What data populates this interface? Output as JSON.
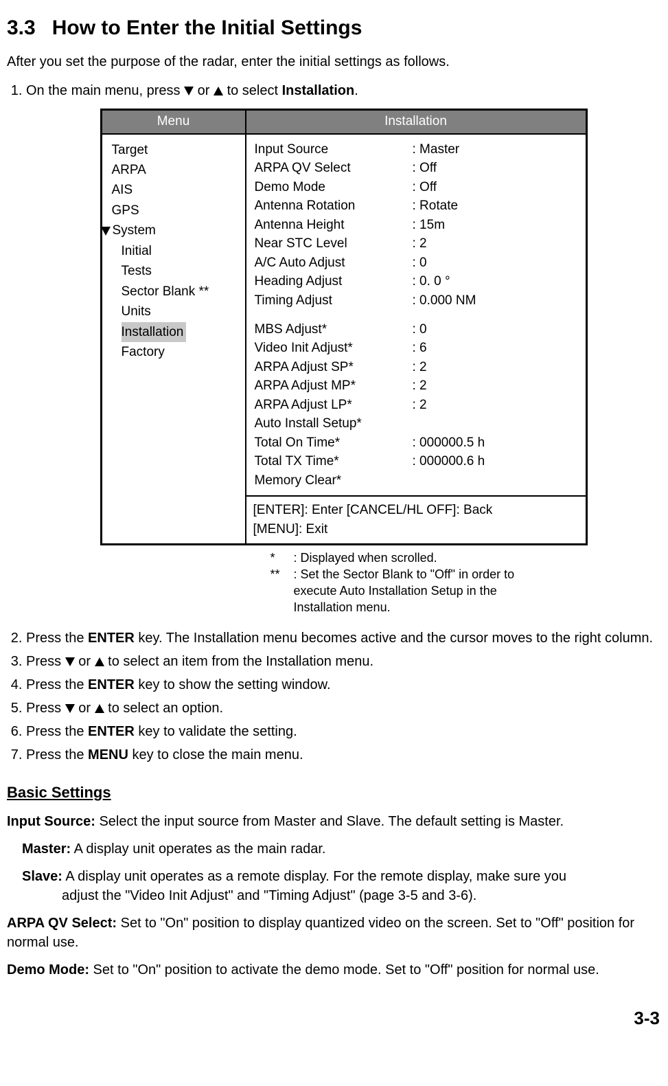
{
  "heading": {
    "number": "3.3",
    "title": "How to Enter the Initial Settings"
  },
  "intro": "After you set the purpose of the radar, enter the initial settings as follows.",
  "steps": {
    "s1a": "On the main menu, press ",
    "s1b": " or ",
    "s1c": " to select ",
    "s1d": "Installation",
    "s1e": ".",
    "s2a": "Press the ",
    "s2b": "ENTER",
    "s2c": " key. The Installation menu becomes active and the cursor moves to the right column.",
    "s3a": "Press ",
    "s3b": " or ",
    "s3c": " to select an item from the Installation menu.",
    "s4a": "Press the ",
    "s4b": "ENTER",
    "s4c": " key to show the setting window.",
    "s5a": "Press ",
    "s5b": " or ",
    "s5c": " to select an option.",
    "s6a": "Press the ",
    "s6b": "ENTER",
    "s6c": " key to validate the setting.",
    "s7a": "Press the ",
    "s7b": "MENU",
    "s7c": " key to close the main menu."
  },
  "menu": {
    "leftTitle": "Menu",
    "rightTitle": "Installation",
    "left": {
      "target": "Target",
      "arpa": "ARPA",
      "ais": "AIS",
      "gps": "GPS",
      "system": "System",
      "initial": "Initial",
      "tests": "Tests",
      "sectorBlank": "Sector Blank **",
      "units": "Units",
      "installation": "Installation",
      "factory": "Factory"
    },
    "right": [
      {
        "label": "Input Source",
        "value": ": Master"
      },
      {
        "label": "ARPA QV Select",
        "value": ": Off"
      },
      {
        "label": "Demo Mode",
        "value": ": Off"
      },
      {
        "label": "Antenna Rotation",
        "value": ": Rotate"
      },
      {
        "label": "Antenna Height",
        "value": ": 15m"
      },
      {
        "label": "Near STC Level",
        "value": ": 2"
      },
      {
        "label": "A/C Auto Adjust",
        "value": ": 0"
      },
      {
        "label": "Heading Adjust",
        "value": ": 0. 0 °"
      },
      {
        "label": "Timing Adjust",
        "value": ": 0.000 NM"
      },
      {
        "label": "MBS Adjust*",
        "value": ":  0"
      },
      {
        "label": "Video Init Adjust*",
        "value": ":  6"
      },
      {
        "label": "ARPA Adjust SP*",
        "value": ":  2"
      },
      {
        "label": "ARPA Adjust MP*",
        "value": ":  2"
      },
      {
        "label": "ARPA Adjust LP*",
        "value": ":  2"
      },
      {
        "label": "Auto Install Setup*",
        "value": ""
      },
      {
        "label": "Total On Time*",
        "value": ": 000000.5 h"
      },
      {
        "label": "Total TX Time*",
        "value": ": 000000.6 h"
      },
      {
        "label": "Memory Clear*",
        "value": ""
      }
    ],
    "hints": {
      "line1": "[ENTER]: Enter   [CANCEL/HL OFF]: Back",
      "line2": "[MENU]: Exit"
    }
  },
  "footnotes": {
    "f1": ": Displayed when scrolled.",
    "f2a": ": Set the Sector Blank to \"Off\" in order to",
    "f2b": "execute Auto Installation Setup in  the",
    "f2c": "Installation menu."
  },
  "basic": {
    "heading": "Basic Settings",
    "inputSourceTitle": "Input Source:",
    "inputSourceBody": " Select the input source from Master and Slave. The default setting is Master.",
    "masterTitle": "Master:",
    "masterBody": " A display unit operates as the main radar.",
    "slaveTitle": "Slave:",
    "slaveBody1": " A display unit operates as a remote display. For the remote display, make sure you",
    "slaveBody2": "adjust the \"Video Init Adjust\" and \"Timing Adjust\" (page 3-5 and 3-6).",
    "arpaqvTitle": "ARPA QV Select:",
    "arpaqvBody": " Set to \"On\" position to display quantized video on the screen. Set to \"Off\" position for normal use.",
    "demoTitle": "Demo Mode:",
    "demoBody": " Set to \"On\" position to activate the demo mode. Set to \"Off\" position for normal use."
  },
  "pageNumber": "3-3"
}
